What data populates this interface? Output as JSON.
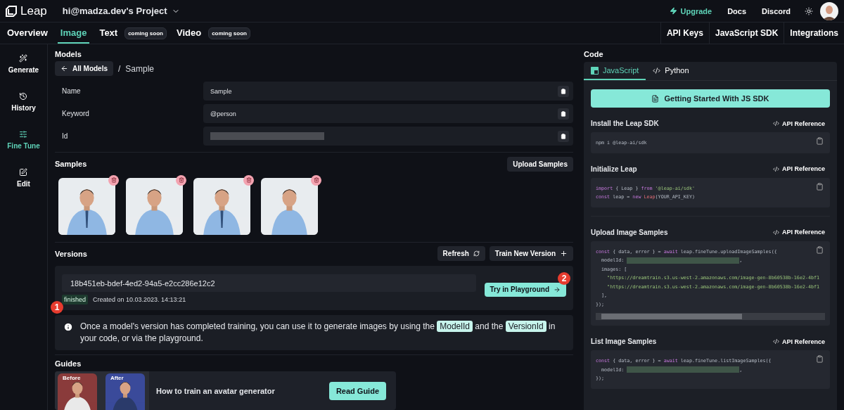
{
  "header": {
    "logo": "Leap",
    "project": "hi@madza.dev's Project",
    "links": [
      {
        "label": "Upgrade",
        "kind": "upgrade"
      },
      {
        "label": "Docs",
        "kind": "plain"
      },
      {
        "label": "Discord",
        "kind": "plain"
      }
    ]
  },
  "nav": {
    "tabs": [
      {
        "label": "Overview",
        "selected": false
      },
      {
        "label": "Image",
        "selected": true
      },
      {
        "label": "Text",
        "selected": false,
        "badge": "coming soon"
      },
      {
        "label": "Video",
        "selected": false,
        "badge": "coming soon"
      }
    ],
    "links": [
      "API Keys",
      "JavaScript SDK",
      "Integrations"
    ]
  },
  "sidebar": [
    {
      "label": "Generate",
      "selected": false
    },
    {
      "label": "History",
      "selected": false
    },
    {
      "label": "Fine Tune",
      "selected": true
    },
    {
      "label": "Edit",
      "selected": false
    }
  ],
  "models": {
    "title": "Models",
    "back": "All Models",
    "separator": "/",
    "current": "Sample",
    "fields": [
      {
        "label": "Name",
        "value": "Sample",
        "redacted": false
      },
      {
        "label": "Keyword",
        "value": "@person",
        "redacted": false
      },
      {
        "label": "Id",
        "redacted": true
      }
    ]
  },
  "samples": {
    "title": "Samples",
    "upload": "Upload Samples"
  },
  "versions": {
    "title": "Versions",
    "refresh": "Refresh",
    "train": "Train New Version",
    "id": "18b451eb-bdef-4ed2-94a5-e2cc286e12c2",
    "status": "finished",
    "created": "Created on 10.03.2023. 14:13:21",
    "try": "Try in Playground",
    "info": [
      {
        "kind": "text",
        "text": "Once a model's version has completed training, you can use it to generate images by using the "
      },
      {
        "kind": "chip",
        "text": "ModelId"
      },
      {
        "kind": "text",
        "text": " and the "
      },
      {
        "kind": "chip",
        "text": "VersionId"
      },
      {
        "kind": "text",
        "text": " in your code, or via the playground."
      }
    ]
  },
  "guides": {
    "title": "Guides",
    "items": [
      {
        "before": "Before",
        "after": "After",
        "title": "How to train an avatar generator",
        "button": "Read Guide"
      }
    ]
  },
  "markers": [
    "1",
    "2"
  ],
  "code": {
    "title": "Code",
    "tabs": [
      {
        "label": "JavaScript",
        "selected": true
      },
      {
        "label": "Python",
        "selected": false
      }
    ],
    "start": "Getting Started With JS SDK",
    "sections": [
      {
        "title": "Install the Leap SDK",
        "ref": "API Reference",
        "scroll": false,
        "lines": [
          [
            {
              "kind": "plain",
              "text": "npm i @leap-ai/sdk"
            }
          ]
        ]
      },
      {
        "title": "Initialize Leap",
        "ref": "API Reference",
        "scroll": false,
        "lines": [
          [
            {
              "kind": "kw",
              "text": "import"
            },
            {
              "kind": "plain",
              "text": " { Leap } "
            },
            {
              "kind": "kw",
              "text": "from"
            },
            {
              "kind": "str",
              "text": " '@leap-ai/sdk'"
            }
          ],
          [
            {
              "kind": "kw",
              "text": "const"
            },
            {
              "kind": "plain",
              "text": " leap = "
            },
            {
              "kind": "kw",
              "text": "new"
            },
            {
              "kind": "fn",
              "text": " Leap"
            },
            {
              "kind": "plain",
              "text": "(YOUR_API_KEY)"
            }
          ]
        ]
      },
      {
        "title": "Upload Image Samples",
        "ref": "API Reference",
        "scroll": true,
        "lines": [
          [
            {
              "kind": "kw",
              "text": "const"
            },
            {
              "kind": "plain",
              "text": " { data, error } = "
            },
            {
              "kind": "kw",
              "text": "await"
            },
            {
              "kind": "plain",
              "text": " leap.fineTune.uploadImageSamples({"
            }
          ],
          [
            {
              "kind": "plain",
              "text": "  modelId: "
            },
            {
              "kind": "redacted"
            },
            {
              "kind": "plain",
              "text": ","
            }
          ],
          [
            {
              "kind": "plain",
              "text": "  images: ["
            }
          ],
          [
            {
              "kind": "str",
              "text": "    \"https://dreamtrain.s3.us-west-2.amazonaws.com/image-gen-8b60538b-16e2-4bf1"
            }
          ],
          [
            {
              "kind": "str",
              "text": "    \"https://dreamtrain.s3.us-west-2.amazonaws.com/image-gen-8b60538b-16e2-4bf1"
            }
          ],
          [
            {
              "kind": "plain",
              "text": "  ],"
            }
          ],
          [
            {
              "kind": "plain",
              "text": "});"
            }
          ]
        ]
      },
      {
        "title": "List Image Samples",
        "ref": "API Reference",
        "scroll": false,
        "lines": [
          [
            {
              "kind": "kw",
              "text": "const"
            },
            {
              "kind": "plain",
              "text": " { data, error } = "
            },
            {
              "kind": "kw",
              "text": "await"
            },
            {
              "kind": "plain",
              "text": " leap.fineTune.listImageSamples({"
            }
          ],
          [
            {
              "kind": "plain",
              "text": "  modelId: "
            },
            {
              "kind": "redacted"
            },
            {
              "kind": "plain",
              "text": ","
            }
          ],
          [
            {
              "kind": "plain",
              "text": "});"
            }
          ]
        ]
      }
    ]
  }
}
